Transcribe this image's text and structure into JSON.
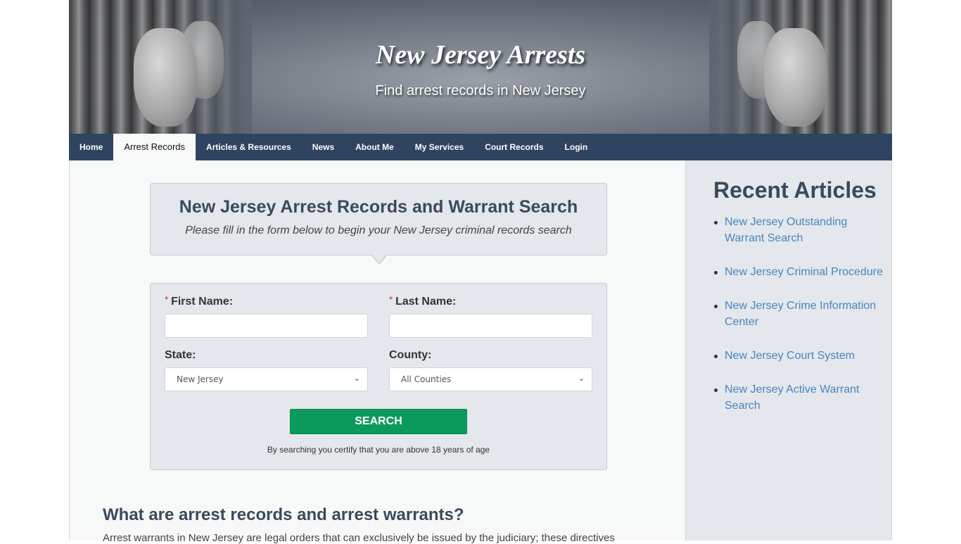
{
  "header": {
    "title": "New Jersey Arrests",
    "tagline": "Find arrest records in New Jersey"
  },
  "nav": {
    "items": [
      {
        "label": "Home",
        "active": false
      },
      {
        "label": "Arrest Records",
        "active": true
      },
      {
        "label": "Articles & Resources",
        "active": false
      },
      {
        "label": "News",
        "active": false
      },
      {
        "label": "About Me",
        "active": false
      },
      {
        "label": "My Services",
        "active": false
      },
      {
        "label": "Court Records",
        "active": false
      },
      {
        "label": "Login",
        "active": false
      }
    ]
  },
  "search": {
    "title": "New Jersey Arrest Records and Warrant Search",
    "subtitle": "Please fill in the form below to begin your New Jersey criminal records search",
    "required_marker": "*",
    "first_name_label": "First Name:",
    "first_name_value": "",
    "last_name_label": "Last Name:",
    "last_name_value": "",
    "state_label": "State:",
    "state_value": "New Jersey",
    "county_label": "County:",
    "county_value": "All Counties",
    "button_label": "SEARCH",
    "disclaimer": "By searching you certify that you are above 18 years of age"
  },
  "article": {
    "heading": "What are arrest records and arrest warrants?",
    "paragraph": "Arrest warrants in New Jersey are legal orders that can exclusively be issued by the judiciary; these directives"
  },
  "sidebar": {
    "title": "Recent Articles",
    "items": [
      {
        "label": "New Jersey Outstanding Warrant Search"
      },
      {
        "label": "New Jersey Criminal Procedure"
      },
      {
        "label": "New Jersey Crime Information Center"
      },
      {
        "label": "New Jersey Court System"
      },
      {
        "label": "New Jersey Active Warrant Search"
      }
    ]
  },
  "colors": {
    "nav_bg": "#2e4460",
    "search_button": "#0c9a5c",
    "link": "#4a84be",
    "heading": "#3a4a5c"
  }
}
